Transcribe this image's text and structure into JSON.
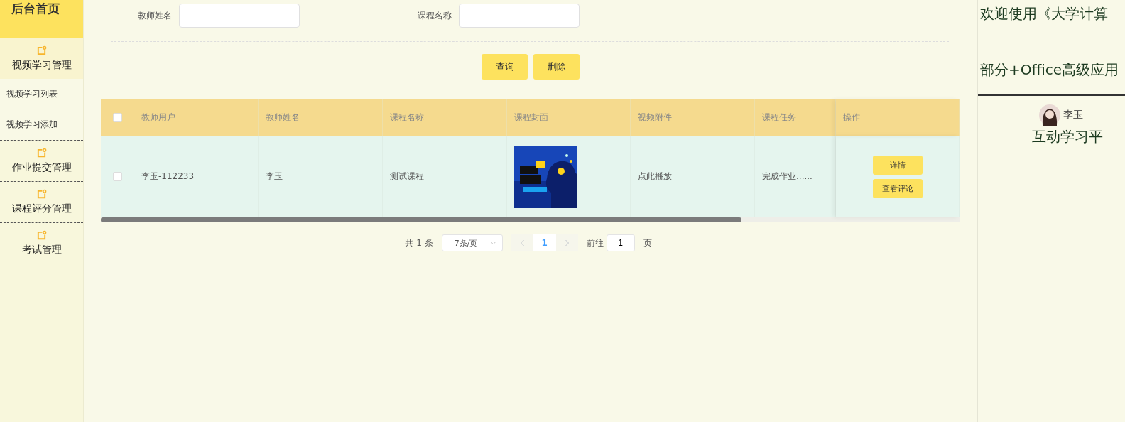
{
  "sidebar": {
    "header": "后台首页",
    "items": [
      {
        "label": "视频学习管理",
        "expanded": true,
        "children": [
          {
            "label": "视频学习列表"
          },
          {
            "label": "视频学习添加"
          }
        ]
      },
      {
        "label": "作业提交管理",
        "expanded": false
      },
      {
        "label": "课程评分管理",
        "expanded": false
      },
      {
        "label": "考试管理",
        "expanded": false
      }
    ]
  },
  "search": {
    "fields": [
      {
        "label": "教师姓名"
      },
      {
        "label": "课程名称"
      }
    ],
    "buttons": [
      "查询",
      "删除"
    ]
  },
  "table": {
    "header_checked": false,
    "columns": [
      "教师用户",
      "教师姓名",
      "课程名称",
      "课程封面",
      "视频附件",
      "课程任务",
      "操作"
    ],
    "rows": [
      {
        "checked": false,
        "cells": [
          {
            "kind": "text",
            "text": "李玉-112233"
          },
          {
            "kind": "text",
            "text": "李玉"
          },
          {
            "kind": "text",
            "text": "测试课程"
          },
          {
            "kind": "picture"
          },
          {
            "kind": "link",
            "text": "点此播放"
          },
          {
            "kind": "text",
            "text": "完成作业......"
          }
        ],
        "actions": [
          "详情",
          "查看评论"
        ]
      }
    ]
  },
  "pagination": {
    "total": "共 1 条",
    "page_size": "7条/页",
    "pages": [
      {
        "label": "1",
        "selected": true
      }
    ],
    "goto_label": "前往",
    "goto_value": "1",
    "goto_suffix": "页"
  },
  "welcome": {
    "lines": [
      "欢迎使用《大学计算",
      "部分+Office高级应用"
    ],
    "user": "李玉",
    "platform": "互动学习平"
  }
}
